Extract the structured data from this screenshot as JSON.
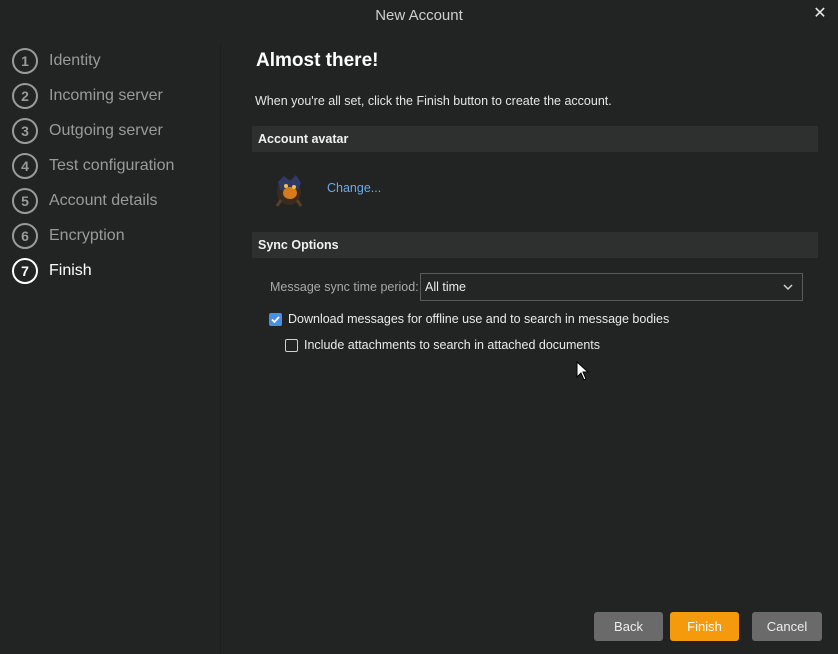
{
  "window": {
    "title": "New Account"
  },
  "steps": [
    {
      "number": "1",
      "label": "Identity"
    },
    {
      "number": "2",
      "label": "Incoming server"
    },
    {
      "number": "3",
      "label": "Outgoing server"
    },
    {
      "number": "4",
      "label": "Test configuration"
    },
    {
      "number": "5",
      "label": "Account details"
    },
    {
      "number": "6",
      "label": "Encryption"
    },
    {
      "number": "7",
      "label": "Finish"
    }
  ],
  "active_step": 7,
  "main": {
    "heading": "Almost there!",
    "description": "When you're all set, click the Finish button to create the account.",
    "avatar_section": {
      "title": "Account avatar",
      "change_link": "Change..."
    },
    "sync_section": {
      "title": "Sync Options",
      "period_label": "Message sync time period:",
      "period_value": "All time",
      "download_label": "Download messages for offline use and to search in message bodies",
      "download_checked": true,
      "attachments_label": "Include attachments to search in attached documents",
      "attachments_checked": false
    }
  },
  "buttons": {
    "back": "Back",
    "finish": "Finish",
    "cancel": "Cancel"
  },
  "colors": {
    "background": "#222423",
    "accent": "#f59a0c",
    "link": "#6aa9e9",
    "checkbox": "#4a8fe7"
  },
  "icons": [
    "close-icon",
    "chevron-down-icon",
    "checkmark-icon",
    "mouse-cursor-icon"
  ]
}
